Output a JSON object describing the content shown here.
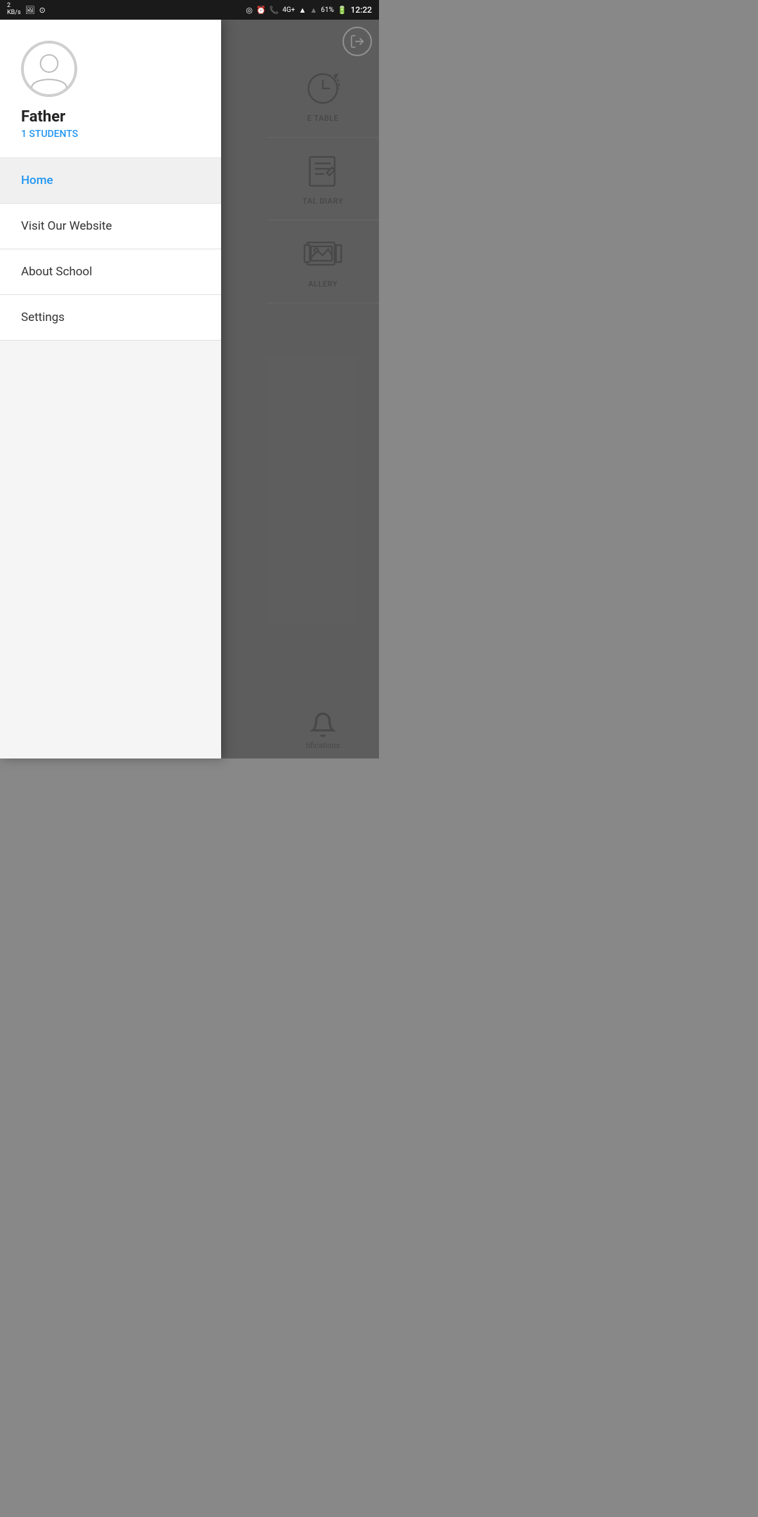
{
  "statusBar": {
    "left": {
      "speed": "2\nKB/s",
      "icons": [
        "photo-icon",
        "circle-icon"
      ]
    },
    "right": {
      "network": "4G+",
      "signal1": "4G+",
      "battery": "61%",
      "time": "12:22"
    }
  },
  "drawer": {
    "profile": {
      "name": "Father",
      "role": "1 STUDENTS"
    },
    "menuItems": [
      {
        "label": "Home",
        "active": true
      },
      {
        "label": "Visit Our Website",
        "active": false
      },
      {
        "label": "About School",
        "active": false
      },
      {
        "label": "Settings",
        "active": false
      }
    ]
  },
  "bgMenu": {
    "logoutIcon": "logout-icon",
    "items": [
      {
        "label": "E TABLE",
        "icon": "timetable-icon"
      },
      {
        "label": "TAL DIARY",
        "icon": "diary-icon"
      },
      {
        "label": "ALLERY",
        "icon": "gallery-icon"
      }
    ],
    "notification": {
      "icon": "bell-icon",
      "label": "tifications"
    }
  },
  "colors": {
    "accent": "#2196F3",
    "background": "#6e6e6e",
    "drawerBg": "#ffffff",
    "statusBar": "#1a1a1a"
  }
}
